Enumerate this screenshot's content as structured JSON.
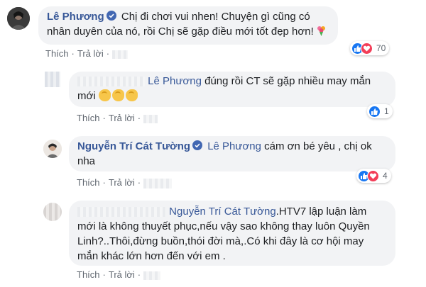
{
  "comments": [
    {
      "author": "Lê Phương",
      "text": "Chị đi chơi vui nhen! Chuyện gì cũng có nhân duyên của nó, rồi Chị sẽ gặp điều mới tốt đẹp hơn!",
      "actions": {
        "like": "Thích",
        "reply": "Trả lời"
      },
      "reaction_count": "70",
      "reaction_types": [
        "like",
        "love"
      ]
    },
    {
      "author": "",
      "tag": "Lê Phương",
      "text": "đúng rồi CT sẽ gặp nhiều may mắn mới",
      "actions": {
        "like": "Thích",
        "reply": "Trả lời"
      },
      "reaction_count": "1",
      "reaction_types": [
        "like"
      ]
    },
    {
      "author": "Nguyễn Trí Cát Tường",
      "tag": "Lê Phương",
      "text": "cám ơn bé yêu , chị ok nha",
      "actions": {
        "like": "Thích",
        "reply": "Trả lời"
      },
      "reaction_count": "4",
      "reaction_types": [
        "like",
        "love"
      ]
    },
    {
      "author": "",
      "tag": "Nguyễn Trí Cát Tường",
      "text": ".HTV7 lập luận làm mới là không thuyết phục,nếu vậy sao không thay luôn Quyền Linh?..Thôi,đừng buồn,thói đời mà,.Có khi đây là cơ hội may mắn khác lớn hơn đến với em .",
      "actions": {
        "like": "Thích",
        "reply": "Trả lời"
      }
    }
  ],
  "colors": {
    "author_link": "#385898",
    "bubble_bg": "#f2f3f5",
    "meta_text": "#606770",
    "like_blue": "#1877f2",
    "love_red": "#f33e58",
    "verified_blue": "#4267b2"
  },
  "icons": [
    "verified-badge-icon",
    "like-reaction-icon",
    "love-reaction-icon",
    "flexed-biceps-emoji-icon",
    "bouquet-emoji-icon"
  ]
}
